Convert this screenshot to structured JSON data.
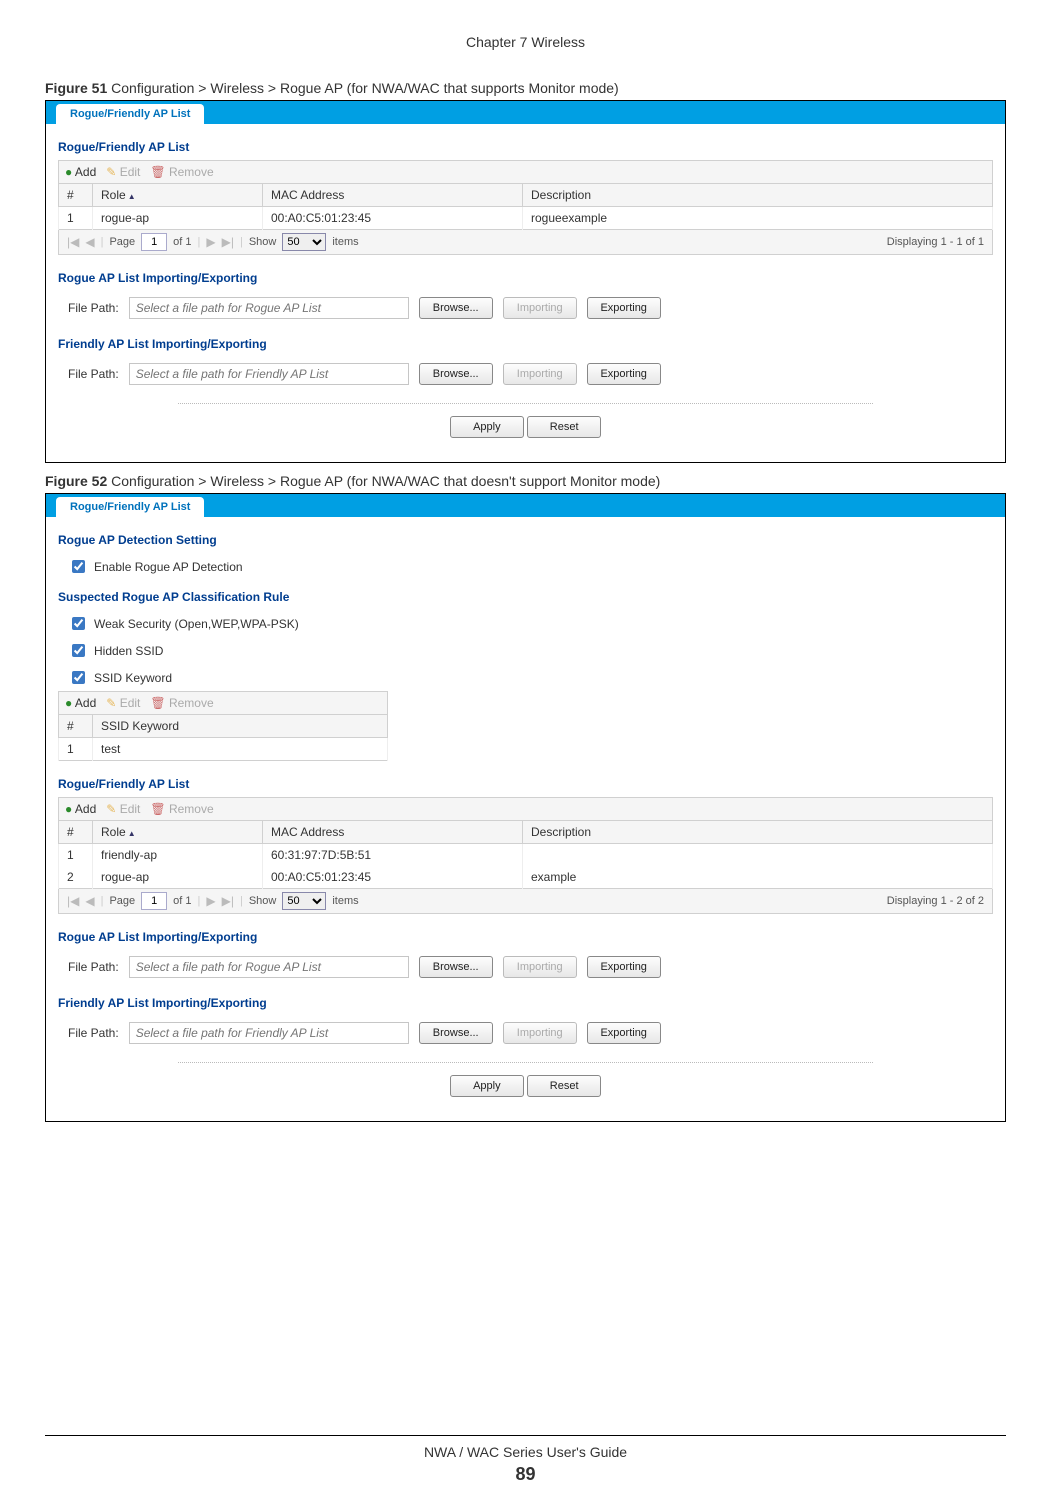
{
  "page": {
    "chapter_heading": "Chapter 7 Wireless",
    "footer_guide": "NWA / WAC Series User's Guide",
    "footer_page": "89"
  },
  "common": {
    "tab_label": "Rogue/Friendly AP List",
    "toolbar": {
      "add": "Add",
      "edit": "Edit",
      "remove": "Remove"
    },
    "table_headers": {
      "num": "#",
      "role": "Role",
      "mac": "MAC Address",
      "desc": "Description",
      "ssid_kw": "SSID Keyword"
    },
    "pager": {
      "page_label": "Page",
      "of_label": "of 1",
      "show_label": "Show",
      "items_label": "items",
      "page_value": "1",
      "show_value": "50"
    },
    "file": {
      "label": "File Path:",
      "browse": "Browse...",
      "importing": "Importing",
      "exporting": "Exporting"
    },
    "actions": {
      "apply": "Apply",
      "reset": "Reset"
    }
  },
  "fig51": {
    "caption_b": "Figure 51",
    "caption_t": "   Configuration > Wireless > Rogue AP (for NWA/WAC that supports Monitor mode)",
    "sections": {
      "list_title": "Rogue/Friendly AP List",
      "rogue_import_title": "Rogue AP List Importing/Exporting",
      "friendly_import_title": "Friendly AP List Importing/Exporting"
    },
    "rows": [
      {
        "n": "1",
        "role": "rogue-ap",
        "mac": "00:A0:C5:01:23:45",
        "desc": "rogueexample"
      }
    ],
    "display_text": "Displaying 1 - 1 of 1",
    "rogue_placeholder": "Select a file path for Rogue AP List",
    "friendly_placeholder": "Select a file path for Friendly AP List"
  },
  "fig52": {
    "caption_b": "Figure 52",
    "caption_t": "   Configuration > Wireless > Rogue AP (for NWA/WAC that doesn't support Monitor mode)",
    "sections": {
      "detect_title": "Rogue AP Detection Setting",
      "rule_title": "Suspected Rogue AP Classification Rule",
      "list_title": "Rogue/Friendly AP List",
      "rogue_import_title": "Rogue AP List Importing/Exporting",
      "friendly_import_title": "Friendly AP List Importing/Exporting"
    },
    "checkboxes": {
      "enable": "Enable Rogue AP Detection",
      "weak": "Weak Security (Open,WEP,WPA-PSK)",
      "hidden": "Hidden SSID",
      "ssidkw": "SSID Keyword"
    },
    "kw_rows": [
      {
        "n": "1",
        "kw": "test"
      }
    ],
    "rows": [
      {
        "n": "1",
        "role": "friendly-ap",
        "mac": "60:31:97:7D:5B:51",
        "desc": ""
      },
      {
        "n": "2",
        "role": "rogue-ap",
        "mac": "00:A0:C5:01:23:45",
        "desc": "example"
      }
    ],
    "display_text": "Displaying 1 - 2 of 2",
    "rogue_placeholder": "Select a file path for Rogue AP List",
    "friendly_placeholder": "Select a file path for Friendly AP List"
  }
}
